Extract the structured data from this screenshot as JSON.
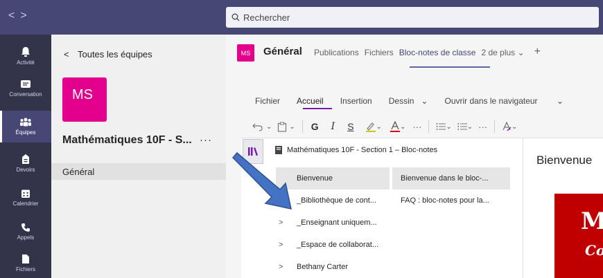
{
  "search": {
    "placeholder": "Rechercher",
    "icon": "search-icon"
  },
  "rail": [
    {
      "label": "Activité",
      "icon": "bell-icon"
    },
    {
      "label": "Conversation",
      "icon": "chat-icon"
    },
    {
      "label": "Équipes",
      "icon": "teams-icon",
      "active": true
    },
    {
      "label": "Devoirs",
      "icon": "assignments-icon"
    },
    {
      "label": "Calendrier",
      "icon": "calendar-icon"
    },
    {
      "label": "Appels",
      "icon": "phone-icon"
    },
    {
      "label": "Fichiers",
      "icon": "files-icon"
    }
  ],
  "team_panel": {
    "back_label": "Toutes les équipes",
    "avatar_initials": "MS",
    "team_name": "Mathématiques 10F - S...",
    "more": "···",
    "channel": "Général"
  },
  "channel_header": {
    "avatar_initials": "MS",
    "title": "Général",
    "tabs": [
      "Publications",
      "Fichiers",
      "Bloc-notes de classe",
      "2 de plus"
    ],
    "active_tab": "Bloc-notes de classe",
    "add": "+"
  },
  "ribbon": {
    "tabs": [
      "Fichier",
      "Accueil",
      "Insertion",
      "Dessin"
    ],
    "active": "Accueil",
    "open_in_browser": "Ouvrir dans le navigateur"
  },
  "toolbar": {
    "bold": "G",
    "italic": "I",
    "underline": "S",
    "more": "···"
  },
  "notebook": {
    "title": "Mathématiques 10F - Section 1 – Bloc-notes",
    "sections": [
      {
        "label": "Bienvenue",
        "selected": true
      },
      {
        "label": "_Bibliothèque de cont..."
      },
      {
        "label": "_Enseignant uniquem..."
      },
      {
        "label": "_Espace de collaborat..."
      },
      {
        "label": "Bethany Carter"
      }
    ],
    "pages": [
      {
        "label": "Bienvenue dans le bloc-...",
        "selected": true
      },
      {
        "label": "FAQ : bloc-notes pour la..."
      }
    ],
    "page_title": "Bienvenue",
    "image_text": [
      "M",
      "Co"
    ]
  },
  "colors": {
    "teams_purple": "#464775",
    "rail": "#33344a",
    "magenta": "#e3008c",
    "onenote": "#7719aa",
    "arrow": "#4472c4"
  }
}
